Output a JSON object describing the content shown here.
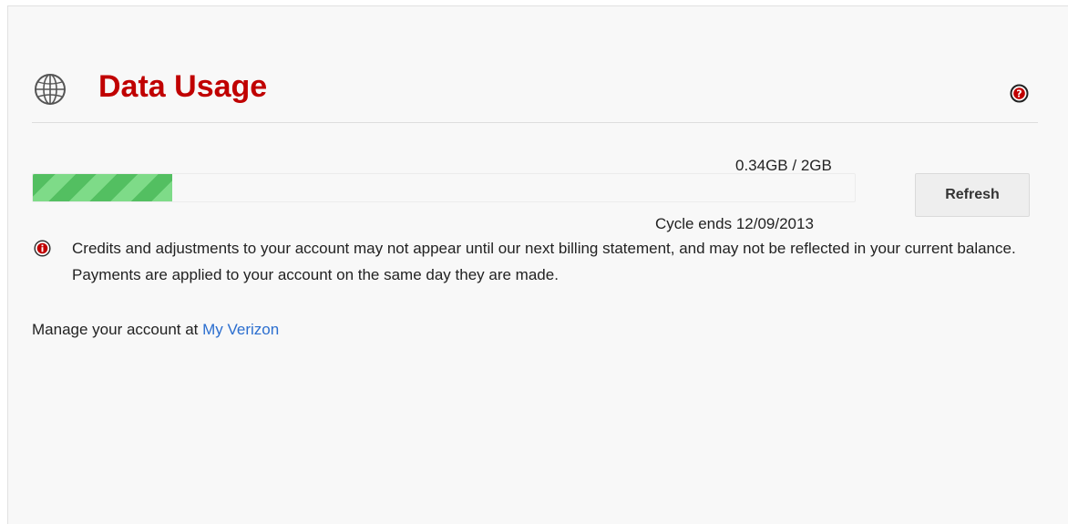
{
  "header": {
    "title": "Data Usage",
    "title_color": "#c00000",
    "icon": "globe-icon",
    "help_icon": "help-icon"
  },
  "usage": {
    "used": "0.34GB",
    "total": "2GB",
    "display": "0.34GB / 2GB",
    "used_fraction": 0.17,
    "bar_color": "#5cc86a",
    "cycle_text": "Cycle ends 12/09/2013"
  },
  "actions": {
    "refresh_label": "Refresh"
  },
  "notice": {
    "icon": "info-icon",
    "text": "Credits and adjustments to your account may not appear until our next billing statement, and may not be reflected in your current balance. Payments are applied to your account on the same day they are made."
  },
  "manage": {
    "prefix": "Manage your account at ",
    "link_label": "My Verizon",
    "link_color": "#2b6ecf"
  }
}
